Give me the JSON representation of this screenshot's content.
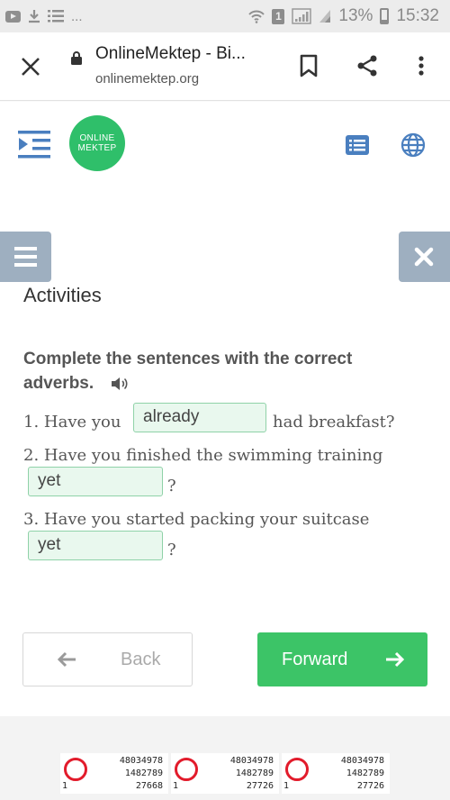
{
  "status_bar": {
    "left_more": "...",
    "battery": "13%",
    "time": "15:32",
    "sim_badge": "1",
    "icons": [
      "youtube-icon",
      "download-icon",
      "list-icon",
      "wifi-icon",
      "signal-icon",
      "battery-icon"
    ]
  },
  "browser": {
    "title": "OnlineMektep - Bi...",
    "host": "onlinemektep.org",
    "icons": [
      "close-icon",
      "lock-icon",
      "bookmark-icon",
      "share-icon",
      "more-vert-icon"
    ]
  },
  "site": {
    "logo_line1": "ONLINE",
    "logo_line2": "MEKTEP",
    "icons": [
      "menu-indent-icon",
      "list-view-icon",
      "globe-icon"
    ]
  },
  "activity": {
    "heading": "Activities",
    "instruction": "Complete the sentences with the correct adverbs.",
    "questions": [
      {
        "before": "1. Have you",
        "answer": "already",
        "after": "had breakfast?"
      },
      {
        "before": "2. Have you finished the swimming training",
        "answer": "yet",
        "after": "?"
      },
      {
        "before": "3. Have you started packing your suitcase",
        "answer": "yet",
        "after": "?"
      }
    ]
  },
  "navigation": {
    "back_label": "Back",
    "forward_label": "Forward"
  },
  "footer_tickets": [
    {
      "line1": "48034978",
      "line2": "1482789",
      "line3": "27668",
      "prefix": "1"
    },
    {
      "line1": "48034978",
      "line2": "1482789",
      "line3": "27726",
      "prefix": "1"
    },
    {
      "line1": "48034978",
      "line2": "1482789",
      "line3": "27726",
      "prefix": "1"
    }
  ],
  "colors": {
    "primary_green": "#3cc467",
    "answer_bg": "#e9f8ee",
    "side_button": "#9eafc0",
    "header_icon": "#4a7fbf"
  }
}
